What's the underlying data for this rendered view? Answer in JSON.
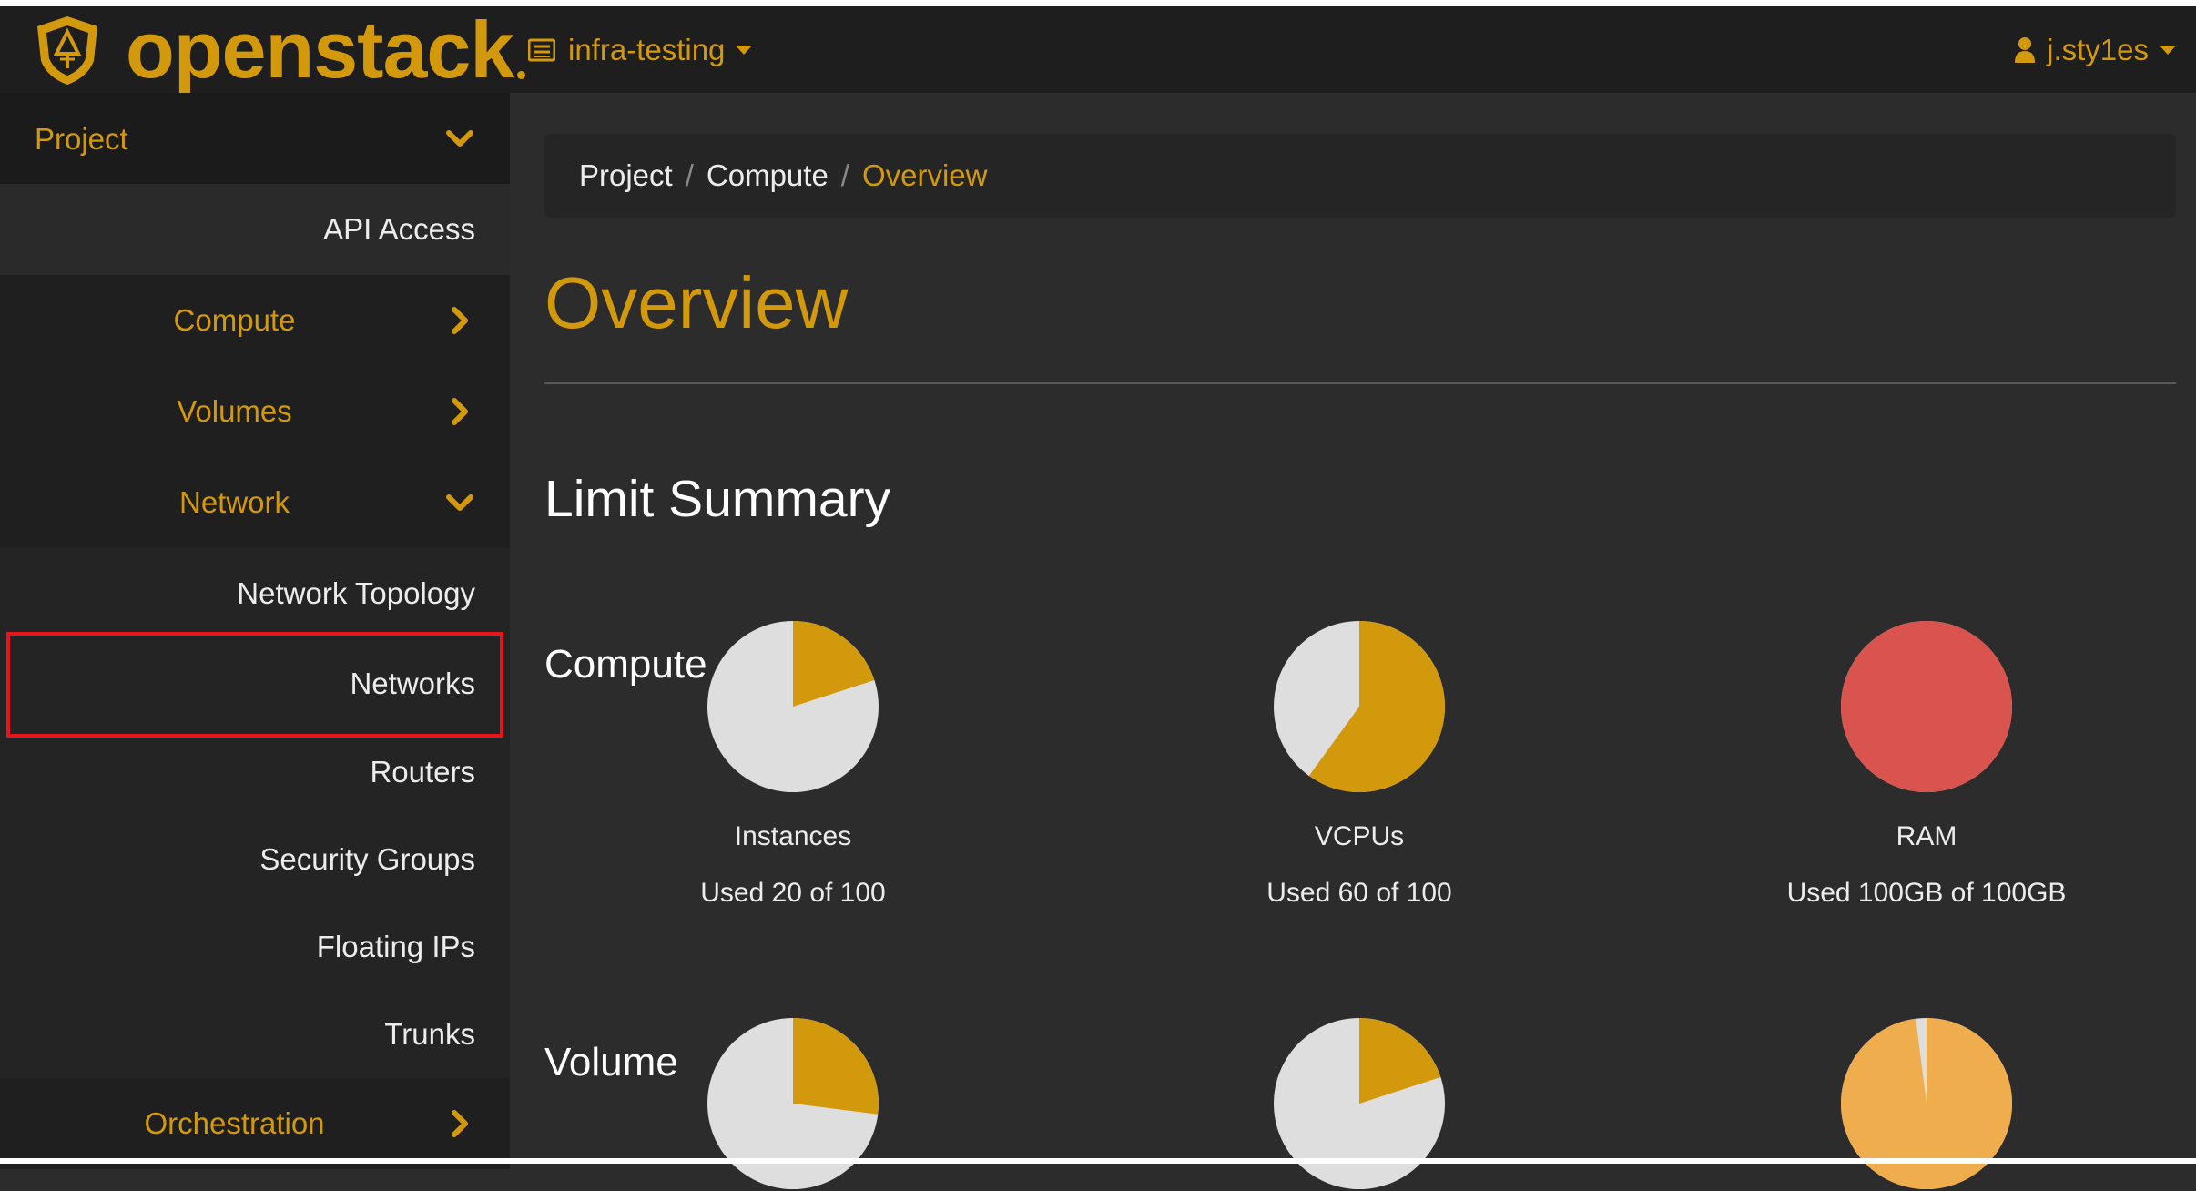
{
  "topbar": {
    "logo_text": "openstack",
    "project": "infra-testing",
    "user": "j.sty1es",
    "brand_color": "#d3990d"
  },
  "sidebar": {
    "header": "Project",
    "items": [
      {
        "label": "API Access"
      },
      {
        "label": "Compute"
      },
      {
        "label": "Volumes"
      },
      {
        "label": "Network"
      },
      {
        "label": "Network Topology"
      },
      {
        "label": "Networks"
      },
      {
        "label": "Routers"
      },
      {
        "label": "Security Groups"
      },
      {
        "label": "Floating IPs"
      },
      {
        "label": "Trunks"
      },
      {
        "label": "Orchestration"
      }
    ]
  },
  "breadcrumb": [
    "Project",
    "Compute",
    "Overview"
  ],
  "page": {
    "title": "Overview",
    "limit_summary": "Limit Summary",
    "compute_heading": "Compute",
    "volume_heading": "Volume"
  },
  "compute": [
    {
      "name": "Instances",
      "used_text": "Used 20 of 100",
      "fraction": 0.2,
      "color": "#d3990d"
    },
    {
      "name": "VCPUs",
      "used_text": "Used 60 of 100",
      "fraction": 0.6,
      "color": "#d3990d"
    },
    {
      "name": "RAM",
      "used_text": "Used 100GB of 100GB",
      "fraction": 1.0,
      "color": "#d9534f"
    }
  ],
  "volume": [
    {
      "fraction": 0.27,
      "color": "#d3990d"
    },
    {
      "fraction": 0.2,
      "color": "#d3990d"
    },
    {
      "fraction": 0.98,
      "color": "#f0ad4e"
    }
  ],
  "colors": {
    "pie_empty": "#dedede",
    "highlight": "#e8141b"
  }
}
